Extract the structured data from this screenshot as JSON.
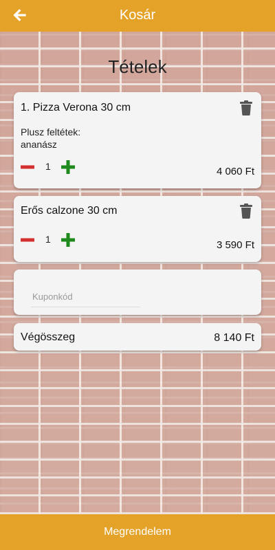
{
  "header": {
    "title": "Kosár"
  },
  "section_title": "Tételek",
  "items": [
    {
      "name": "1. Pizza Verona 30 cm",
      "addon_label": "Plusz feltétek:",
      "addon_value": "ananász",
      "quantity": "1",
      "price": "4 060 Ft"
    },
    {
      "name": "Erős calzone 30 cm",
      "quantity": "1",
      "price": "3 590 Ft"
    }
  ],
  "coupon": {
    "placeholder": "Kuponkód",
    "value": ""
  },
  "total": {
    "label": "Végösszeg",
    "value": "8 140 Ft"
  },
  "order_button": "Megrendelem",
  "colors": {
    "accent": "#e4a228",
    "minus": "#d32f2f",
    "plus": "#1e8a1e",
    "card": "#f4f4f4",
    "trash": "#555555"
  },
  "icons": [
    "arrow-left-icon",
    "trash-icon",
    "minus-icon",
    "plus-icon"
  ]
}
